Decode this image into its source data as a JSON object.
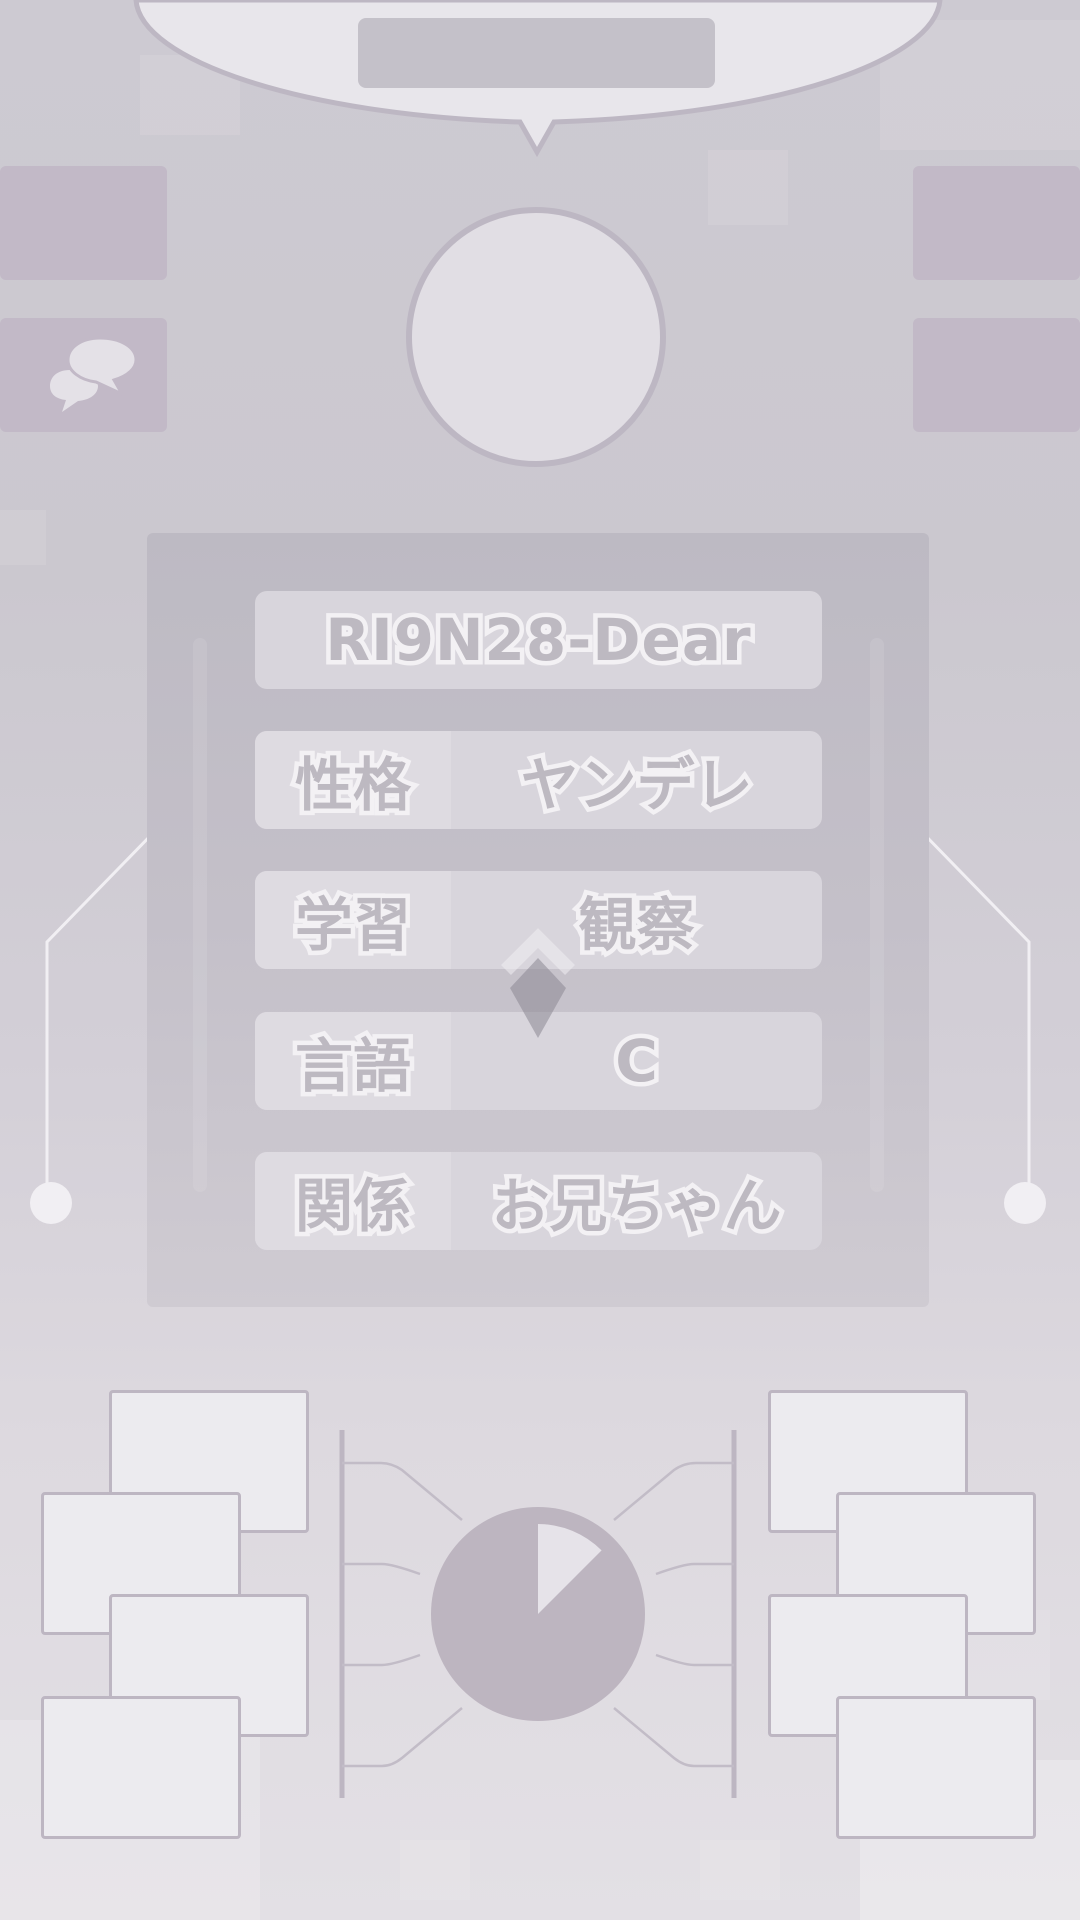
{
  "speech_bubble": {
    "text": ""
  },
  "left_buttons": [
    {
      "name": "menu-button-left-top",
      "icon": ""
    },
    {
      "name": "chat-button",
      "icon": "speech-bubbles-icon"
    }
  ],
  "right_buttons": [
    {
      "name": "menu-button-right-top",
      "icon": ""
    },
    {
      "name": "menu-button-right-bottom",
      "icon": ""
    }
  ],
  "profile": {
    "id": "RI9N28-Dear",
    "rows": [
      {
        "label": "性格",
        "value": "ヤンデレ"
      },
      {
        "label": "学習",
        "value": "観察"
      },
      {
        "label": "言語",
        "value": "C"
      },
      {
        "label": "関係",
        "value": "お兄ちゃん"
      }
    ]
  },
  "timer": {
    "progress": 0.125
  },
  "colors": {
    "background": "#cdcad2",
    "panel": "#bdbac3",
    "row": "#d8d5dc",
    "text": "#bdb9c1",
    "text_outline": "#f3f1f4",
    "card": "#ecebef",
    "card_border": "#bdb6c2",
    "side_button": "#c2b9c7",
    "pie": "#bdb5c0"
  }
}
